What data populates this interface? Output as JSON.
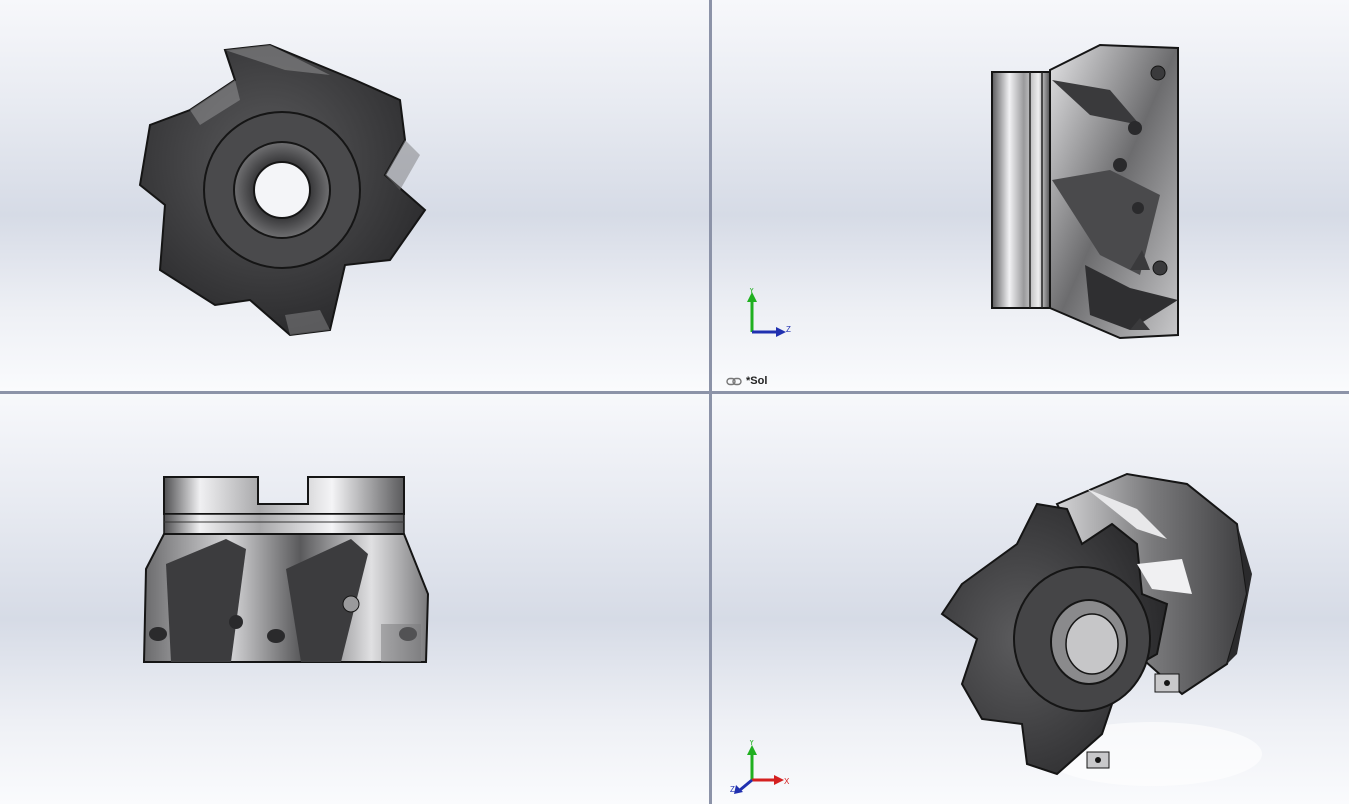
{
  "viewports": [
    {
      "id": "top-left",
      "view": "front"
    },
    {
      "id": "top-right",
      "view": "right"
    },
    {
      "id": "bottom-left",
      "view": "top"
    },
    {
      "id": "bottom-right",
      "view": "isometric"
    }
  ],
  "status": {
    "document_tab_label": "*Sol",
    "document_tab_icon": "linked-chain-icon"
  },
  "triads": {
    "right_view": {
      "y_label": "Y",
      "z_label": "Z"
    },
    "iso_view": {
      "y_label": "Y",
      "x_label": "X",
      "z_label": "Z"
    }
  },
  "colors": {
    "viewport_divider": "#8c93a8",
    "model_dark": "#3c3c3e",
    "model_light": "#d8d8da",
    "axis_x": "#d42020",
    "axis_y": "#20b020",
    "axis_z": "#2030b0"
  }
}
